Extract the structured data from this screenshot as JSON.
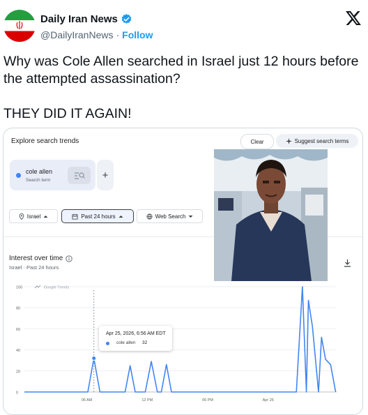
{
  "tweet": {
    "display_name": "Daily Iran News",
    "handle": "@DailyIranNews",
    "separator": "·",
    "follow_label": "Follow",
    "text_line1": "Why was Cole Allen searched in Israel just 12 hours before the attempted assassination?",
    "text_line2": "THEY DID IT AGAIN!"
  },
  "colors": {
    "follow": "#1d9bf0",
    "verified": "#1d9bf0",
    "series": "#4285f4"
  },
  "trends": {
    "explore_title": "Explore search trends",
    "clear_label": "Clear",
    "suggest_label": "Suggest search terms",
    "term": {
      "name": "cole allen",
      "subtitle": "Search term"
    },
    "add_label": "+",
    "filters": {
      "location": "Israel",
      "time": "Past 24 hours",
      "type": "Web Search"
    },
    "section_title": "Interest over time",
    "section_sub": "Israel · Past 24 hours",
    "watermark": "Google Trends"
  },
  "tooltip": {
    "date": "Apr 25, 2026, 6:56 AM EDT",
    "term": "cole allen",
    "value": "32"
  },
  "chart_data": {
    "type": "line",
    "yticks": [
      "100",
      "80",
      "60",
      "40",
      "20",
      "0"
    ],
    "xticks": [
      "06 AM",
      "12 PM",
      "06 PM",
      "Apr 26"
    ],
    "ylim": [
      0,
      100
    ],
    "series": [
      {
        "name": "cole allen",
        "points": [
          [
            0,
            0
          ],
          [
            6.3,
            0
          ],
          [
            6.9,
            32
          ],
          [
            7.5,
            0
          ],
          [
            10.0,
            0
          ],
          [
            10.5,
            25
          ],
          [
            11.0,
            0
          ],
          [
            12.0,
            0
          ],
          [
            12.6,
            29
          ],
          [
            13.2,
            0
          ],
          [
            13.6,
            0
          ],
          [
            14.1,
            26
          ],
          [
            14.6,
            0
          ],
          [
            27.0,
            0
          ],
          [
            27.6,
            100
          ],
          [
            28.0,
            0
          ],
          [
            28.2,
            87
          ],
          [
            28.6,
            62
          ],
          [
            29.2,
            0
          ],
          [
            29.5,
            52
          ],
          [
            29.9,
            31
          ],
          [
            30.4,
            26
          ],
          [
            30.9,
            0
          ]
        ]
      }
    ],
    "x_range": [
      0,
      31
    ],
    "highlight_point": [
      6.9,
      32
    ],
    "grid": true
  }
}
